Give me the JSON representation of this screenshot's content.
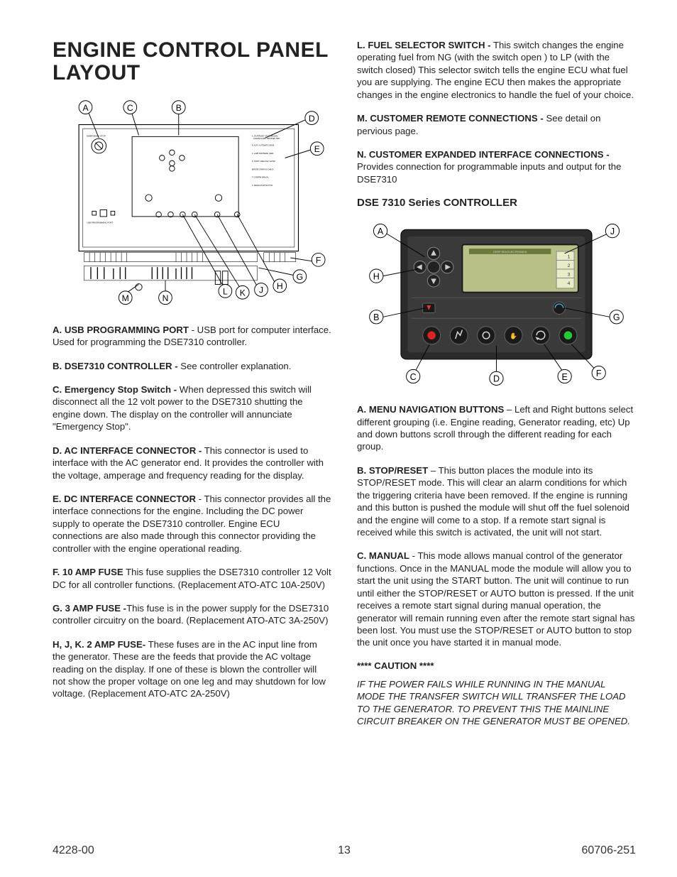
{
  "title": "ENGINE CONTROL PANEL LAYOUT",
  "left": {
    "items": [
      {
        "lead": "A. USB PROGRAMMING PORT",
        "text": " - USB port for computer interface.  Used for programming the DSE7310 controller."
      },
      {
        "lead": "B. DSE7310 CONTROLLER -",
        "text": " See controller explanation."
      },
      {
        "lead": "C. Emergency Stop Switch -",
        "text": "  When depressed this switch will disconnect all the 12 volt power to the DSE7310 shutting the engine down.  The display on the controller will annunciate \"Emergency Stop\"."
      },
      {
        "lead": "D. AC INTERFACE CONNECTOR -",
        "text": " This connector is used to interface with the AC generator end.  It provides the controller with the voltage, amperage and frequency reading for the display."
      },
      {
        "lead": "E.  DC INTERFACE CONNECTOR",
        "text": " - This connector provides all the interface connections for the engine. Including the DC power supply to operate the DSE7310 controller.  Engine ECU connections are also made through this connector providing the controller with the engine operational reading."
      },
      {
        "lead": "F. 10 AMP FUSE",
        "text": " This fuse supplies the DSE7310 controller 12 Volt DC for all controller functions. (Replacement ATO-ATC 10A-250V)"
      },
      {
        "lead": "G. 3 AMP FUSE -",
        "text": "This fuse is in the power supply for the DSE7310 controller circuitry on the board.  (Replacement  ATO-ATC 3A-250V)"
      },
      {
        "lead": "H, J, K. 2 AMP FUSE-",
        "text": "  These fuses are in the AC input line from the generator.  These are the feeds that provide the AC voltage reading on the display.  If one of these is blown the controller will not show the proper voltage on one leg and may shutdown for low voltage. (Replacement ATO-ATC 2A-250V)"
      }
    ]
  },
  "right": {
    "top": [
      {
        "lead": "L.  FUEL SELECTOR SWITCH -",
        "text": " This switch changes the engine operating fuel from NG (with the switch open ) to LP (with the switch closed)  This selector switch tells the engine ECU what fuel you are supplying.  The engine ECU then makes the appropriate changes in the engine electronics to handle the fuel of your choice."
      },
      {
        "lead": "M. CUSTOMER REMOTE CONNECTIONS -",
        "text": " See detail on pervious page."
      },
      {
        "lead": "N. CUSTOMER EXPANDED INTERFACE CONNECTIONS -",
        "text": " Provides connection for programmable inputs and output for the DSE7310"
      }
    ],
    "h2": "DSE 7310 Series CONTROLLER",
    "bottom": [
      {
        "lead": "A. MENU NAVIGATION BUTTONS",
        "text": " – Left and Right buttons select different grouping (i.e. Engine reading, Generator reading, etc) Up and down buttons scroll through the different reading for each group."
      },
      {
        "lead": "B. STOP/RESET",
        "text": " – This button places the module into its STOP/RESET mode.  This will clear an alarm conditions for which the triggering criteria have been removed.  If the engine is running and this button is pushed the module will shut off the fuel solenoid and the engine will come to a stop.  If a remote start signal is received while this switch is activated, the unit will not start."
      },
      {
        "lead": "C. MANUAL",
        "text": "  - This mode allows manual control of the generator functions.  Once in the MANUAL mode the module will allow you to start the unit using the START button.  The unit will continue to run until either the STOP/RESET or AUTO button is pressed.  If the unit receives a remote start signal during manual operation, the generator will remain running even after the remote start signal has been lost.  You must use the STOP/RESET or AUTO button to stop the unit once you have started it in manual mode."
      }
    ],
    "caution_h": "****   CAUTION   ****",
    "caution_b": "IF THE POWER FAILS WHILE RUNNING IN THE MANUAL MODE THE TRANSFER SWITCH WILL TRANSFER THE LOAD TO THE GENERATOR. TO PREVENT THIS THE MAINLINE CIRCUIT BREAKER ON THE GENERATOR MUST BE OPENED."
  },
  "panel_callouts": [
    "A",
    "B",
    "C",
    "D",
    "E",
    "F",
    "G",
    "H",
    "J",
    "K",
    "L",
    "M",
    "N"
  ],
  "ctrl_callouts": [
    "A",
    "B",
    "C",
    "D",
    "E",
    "F",
    "G",
    "H",
    "J"
  ],
  "footer": {
    "left": "4228-00",
    "center": "13",
    "right": "60706-251"
  },
  "panel_tiny_labels": [
    "EMERGENCY STOP",
    "USB PROGRAMMING PORT"
  ],
  "ctrl_screen_label": "DEEP SEA ELECTRONICS",
  "ctrl_screen_nums": [
    "1",
    "2",
    "3",
    "4"
  ]
}
